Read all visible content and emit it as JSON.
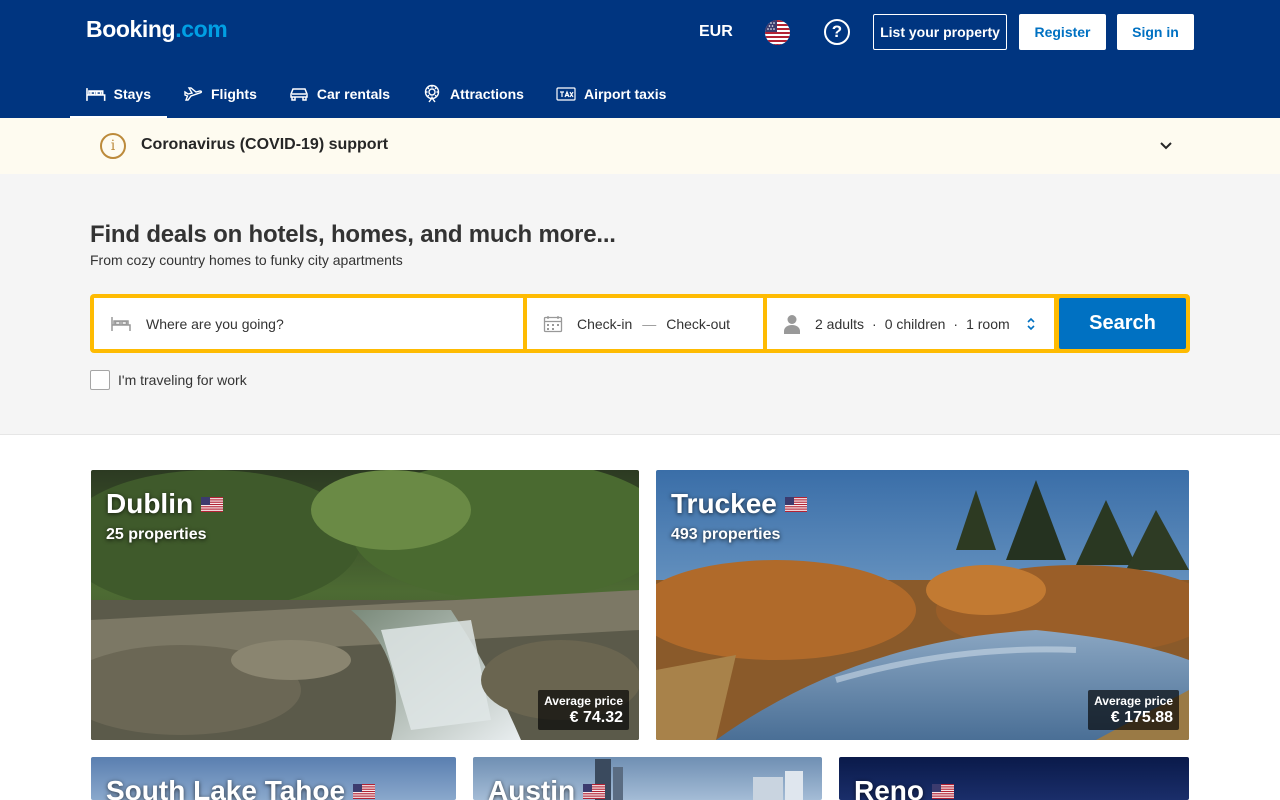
{
  "brand": {
    "logo_main": "Booking",
    "logo_dot": ".com"
  },
  "header": {
    "currency": "EUR",
    "list_property": "List your property",
    "register": "Register",
    "sign_in": "Sign in"
  },
  "nav": [
    {
      "label": "Stays",
      "icon": "bed-icon",
      "active": true
    },
    {
      "label": "Flights",
      "icon": "plane-icon"
    },
    {
      "label": "Car rentals",
      "icon": "car-icon"
    },
    {
      "label": "Attractions",
      "icon": "attractions-icon"
    },
    {
      "label": "Airport taxis",
      "icon": "taxi-icon"
    }
  ],
  "covid": {
    "text": "Coronavirus (COVID-19) support"
  },
  "hero": {
    "title": "Find deals on hotels, homes, and much more...",
    "subtitle": "From cozy country homes to funky city apartments"
  },
  "search": {
    "destination_placeholder": "Where are you going?",
    "checkin": "Check-in",
    "checkout": "Check-out",
    "adults": "2 adults",
    "children": "0 children",
    "rooms": "1 room",
    "button": "Search",
    "work_label": "I'm traveling for work"
  },
  "destinations": [
    {
      "name": "Dublin",
      "properties": "25 properties",
      "price_label": "Average price",
      "price": "€ 74.32"
    },
    {
      "name": "Truckee",
      "properties": "493 properties",
      "price_label": "Average price",
      "price": "€ 175.88"
    },
    {
      "name": "South Lake Tahoe"
    },
    {
      "name": "Austin"
    },
    {
      "name": "Reno"
    }
  ],
  "colors": {
    "brand_blue": "#003580",
    "action_blue": "#0071c2",
    "search_yellow": "#febb02",
    "banner_bg": "#fefbf0"
  }
}
